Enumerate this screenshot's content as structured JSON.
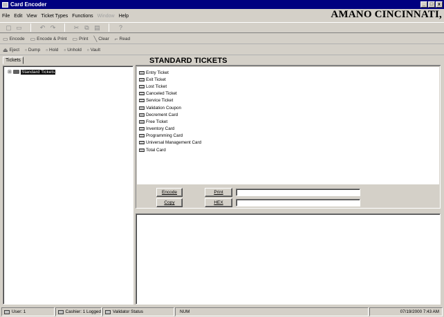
{
  "window": {
    "title": "Card Encoder",
    "controls": [
      "_",
      "□",
      "x"
    ]
  },
  "menu": {
    "items": [
      {
        "label": "File",
        "disabled": false
      },
      {
        "label": "Edit",
        "disabled": false
      },
      {
        "label": "View",
        "disabled": false
      },
      {
        "label": "Ticket Types",
        "disabled": false
      },
      {
        "label": "Functions",
        "disabled": false
      },
      {
        "label": "Window",
        "disabled": true
      },
      {
        "label": "Help",
        "disabled": false
      }
    ],
    "brand": "AMANO CINCINNATI,"
  },
  "toolbar_icons": [
    "new-icon",
    "open-icon",
    "undo-icon",
    "redo-icon",
    "cut-icon",
    "copy-icon",
    "paste-icon",
    "help-icon"
  ],
  "toolbar2": {
    "buttons": [
      {
        "label": "Encode",
        "icon": "card-icon"
      },
      {
        "label": "Encode & Print",
        "icon": "card-icon"
      },
      {
        "label": "Print",
        "icon": "card-icon"
      },
      {
        "label": "Clear",
        "icon": "clear-icon"
      },
      {
        "label": "Read",
        "icon": "read-icon"
      }
    ]
  },
  "toolbar3": {
    "buttons": [
      {
        "label": "Eject",
        "icon": "eject-icon"
      },
      {
        "label": "Dump",
        "icon": "dump-icon"
      },
      {
        "label": "Hold",
        "icon": "hold-icon"
      },
      {
        "label": "Unhold",
        "icon": "unhold-icon"
      },
      {
        "label": "Vault",
        "icon": "vault-icon"
      }
    ]
  },
  "tree": {
    "tab_label": "Tickets",
    "expander": "⊞",
    "root_label": "Standard Tickets"
  },
  "main": {
    "header": "STANDARD TICKETS",
    "tickets": [
      "Entry Ticket",
      "Exit Ticket",
      "Lost Ticket",
      "Canceled Ticket",
      "Service Ticket",
      "Validation Coupon",
      "Decrement Card",
      "Free Ticket",
      "Inventory Card",
      "Programming Card",
      "Universal Management Card",
      "Total Card"
    ],
    "buttons": {
      "encode": "Encode",
      "copy": "Copy",
      "print": "Print",
      "hex": "HEX"
    },
    "fields": {
      "print_value": "",
      "hex_value": ""
    }
  },
  "status": {
    "user": "User: 1",
    "cashier": "Cashier: 1 Logged",
    "validator": "Validator Status",
    "num": "NUM",
    "datetime": "07/19/2000  7:43 AM"
  }
}
